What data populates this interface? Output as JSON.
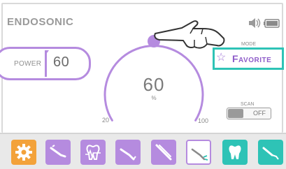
{
  "app": {
    "title": "ENDOSONIC"
  },
  "status_icons": [
    "speaker-icon",
    "battery-icon"
  ],
  "power": {
    "label": "POWER",
    "value": "60"
  },
  "gauge": {
    "value": "60",
    "unit": "%",
    "min_label": "20",
    "max_label": "100",
    "level": 0.5
  },
  "mode": {
    "label": "MODE",
    "favorite_label": "Favorite",
    "favorite_icon": "star-icon"
  },
  "scan": {
    "label": "SCAN",
    "state": "OFF"
  },
  "toolbar": {
    "items": [
      {
        "name": "settings",
        "icon": "gear-icon",
        "color": "#f3a23a"
      },
      {
        "name": "tool-1",
        "icon": "endo-file-icon",
        "color": "#b58bdf"
      },
      {
        "name": "tool-2",
        "icon": "tooth-chart-icon",
        "color": "#b58bdf"
      },
      {
        "name": "tool-3",
        "icon": "scaler-tip-icon",
        "color": "#b58bdf"
      },
      {
        "name": "tool-4",
        "icon": "tweezers-icon",
        "color": "#b58bdf"
      },
      {
        "name": "tool-5",
        "icon": "endo-tip-selected-icon",
        "color": "#ffffff"
      },
      {
        "name": "tool-6",
        "icon": "tooth-icon",
        "color": "#2ec3b6"
      },
      {
        "name": "tool-7",
        "icon": "scaler-icon",
        "color": "#2ec3b6"
      }
    ]
  },
  "colors": {
    "accent_purple": "#b58bdf",
    "accent_teal": "#2ec3b6",
    "accent_orange": "#f3a23a",
    "text_gray": "#7a7a7a"
  }
}
